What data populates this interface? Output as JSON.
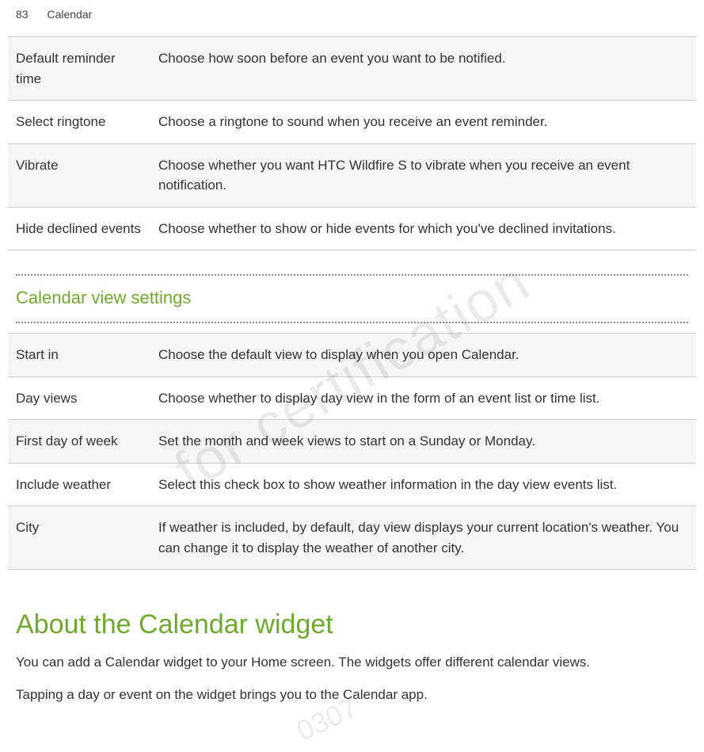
{
  "header": {
    "page_number": "83",
    "section_title": "Calendar"
  },
  "watermark": {
    "text1": "for certification",
    "text2": "0307"
  },
  "table1": [
    {
      "label": "Default reminder time",
      "desc": "Choose how soon before an event you want to be notified."
    },
    {
      "label": "Select ringtone",
      "desc": "Choose a ringtone to sound when you receive an event reminder."
    },
    {
      "label": "Vibrate",
      "desc": "Choose whether you want HTC Wildfire S to vibrate when you receive an event notification."
    },
    {
      "label": "Hide declined events",
      "desc": "Choose whether to show or hide events for which you've declined invitations."
    }
  ],
  "subsection_heading": "Calendar view settings",
  "table2": [
    {
      "label": "Start in",
      "desc": "Choose the default view to display when you open Calendar."
    },
    {
      "label": "Day views",
      "desc": "Choose whether to display day view in the form of an event list or time list."
    },
    {
      "label": "First day of week",
      "desc": "Set the month and week views to start on a Sunday or Monday."
    },
    {
      "label": "Include weather",
      "desc": "Select this check box to show weather information in the day view events list."
    },
    {
      "label": "City",
      "desc": "If weather is included, by default, day view displays your current location's weather. You can change it to display the weather of another city."
    }
  ],
  "main_heading": "About the Calendar widget",
  "paragraphs": [
    "You can add a Calendar widget to your Home screen. The widgets offer different calendar views.",
    "Tapping a day or event on the widget brings you to the Calendar app."
  ]
}
